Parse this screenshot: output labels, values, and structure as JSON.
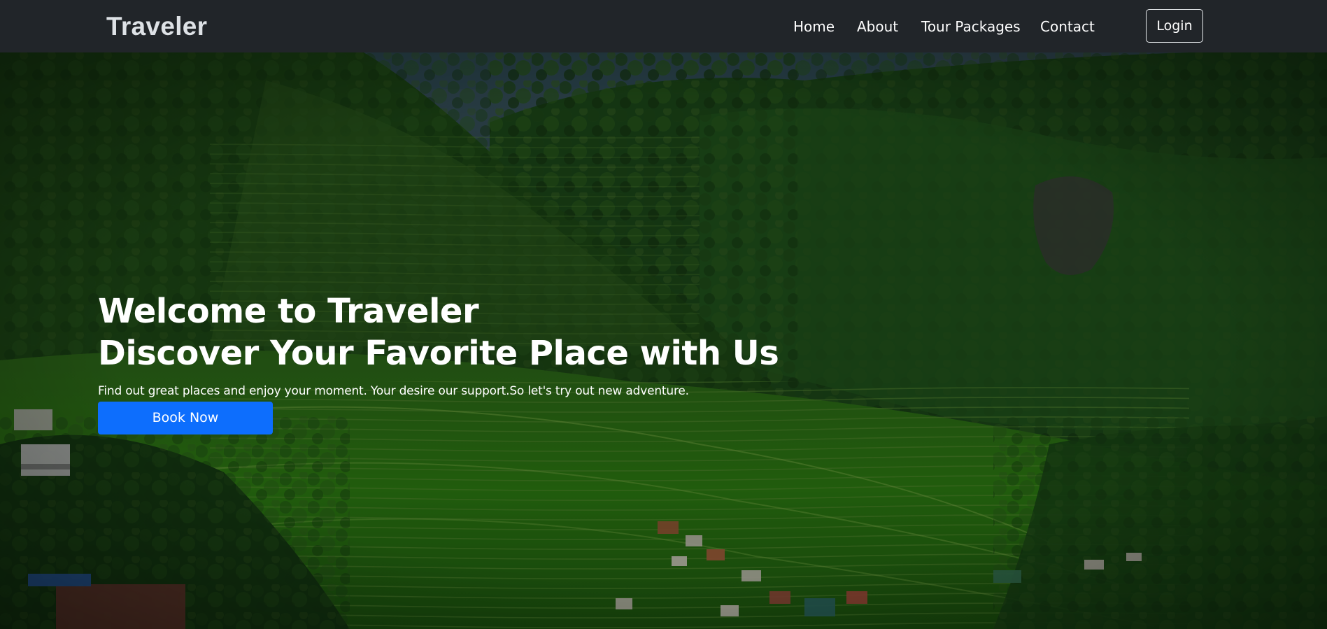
{
  "brand": {
    "name": "Traveler"
  },
  "nav": {
    "items": [
      {
        "label": "Home"
      },
      {
        "label": "About"
      },
      {
        "label": "Tour Packages"
      },
      {
        "label": "Contact"
      }
    ],
    "login_label": "Login"
  },
  "hero": {
    "title_line1": "Welcome to Traveler",
    "title_line2": "Discover Your Favorite Place with Us",
    "subtitle": "Find out great places and enjoy your moment. Your desire our support.So let's try out new adventure.",
    "cta_label": "Book Now",
    "background_scene": "rice-terraces-mountain-valley-photo"
  },
  "colors": {
    "navbar_bg": "#212529",
    "brand_text": "#dee2e6",
    "nav_text": "#ffffff",
    "primary_button": "#0d6efd",
    "hero_text": "#ffffff"
  }
}
